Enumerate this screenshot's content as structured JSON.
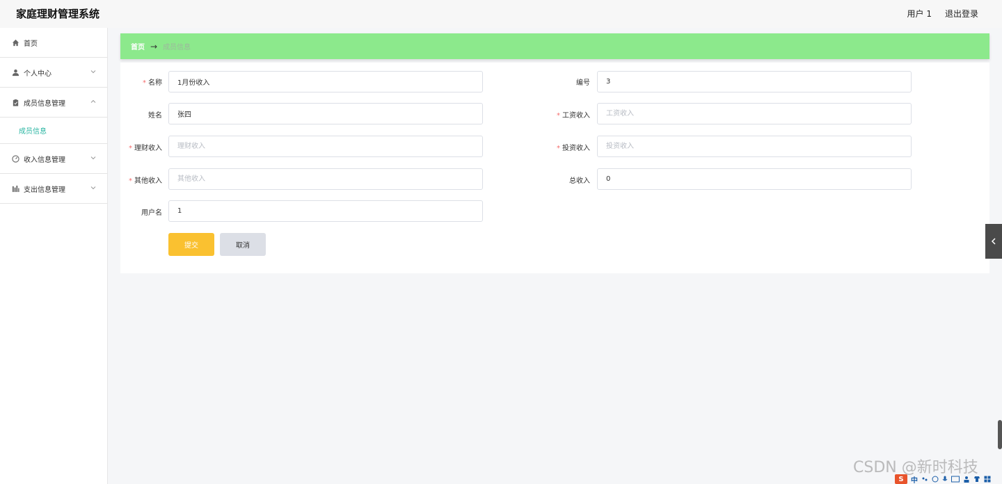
{
  "header": {
    "title": "家庭理财管理系统",
    "user": "用户 1",
    "logout": "退出登录"
  },
  "sidebar": {
    "items": [
      {
        "label": "首页",
        "icon": "home-icon"
      },
      {
        "label": "个人中心",
        "icon": "user-icon"
      },
      {
        "label": "成员信息管理",
        "icon": "clipboard-icon"
      },
      {
        "label": "收入信息管理",
        "icon": "gauge-icon"
      },
      {
        "label": "支出信息管理",
        "icon": "chart-icon"
      }
    ],
    "submenu_active": "成员信息"
  },
  "breadcrumb": {
    "home": "首页",
    "arrow": "→",
    "current": "成员信息"
  },
  "form": {
    "name": {
      "label": "名称",
      "value": "1月份收入",
      "required": true
    },
    "number": {
      "label": "编号",
      "value": "3",
      "required": false
    },
    "person": {
      "label": "姓名",
      "value": "张四",
      "required": false
    },
    "salary": {
      "label": "工资收入",
      "placeholder": "工资收入",
      "required": true
    },
    "finance": {
      "label": "理财收入",
      "placeholder": "理财收入",
      "required": true
    },
    "invest": {
      "label": "投资收入",
      "placeholder": "投资收入",
      "required": true
    },
    "other": {
      "label": "其他收入",
      "placeholder": "其他收入",
      "required": true
    },
    "total": {
      "label": "总收入",
      "value": "0",
      "required": false
    },
    "username": {
      "label": "用户名",
      "value": "1",
      "required": false
    },
    "required_mark": "*",
    "submit": "提交",
    "cancel": "取消"
  },
  "watermark": "CSDN @新时科技",
  "ime": {
    "logo": "S",
    "text": "中"
  },
  "colors": {
    "breadcrumb_bg": "#8ce98c",
    "submit_bg": "#fac130",
    "active_submenu": "#2bb6a3",
    "required": "#f56c6c"
  }
}
